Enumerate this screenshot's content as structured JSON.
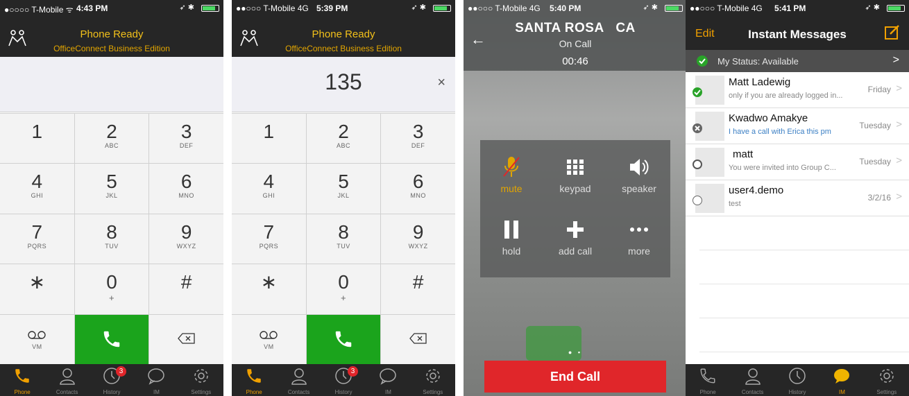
{
  "screens": {
    "dialer_empty": {
      "status": {
        "carrier": "●○○○○ T-Mobile ᯤ",
        "time": "4:43 PM"
      },
      "header": {
        "title": "Phone Ready",
        "subtitle": "OfficeConnect Business Edition",
        "logo_icon": "people-connect-icon"
      },
      "display_number": "",
      "keys": [
        {
          "digit": "1",
          "letters": ""
        },
        {
          "digit": "2",
          "letters": "ABC"
        },
        {
          "digit": "3",
          "letters": "DEF"
        },
        {
          "digit": "4",
          "letters": "GHI"
        },
        {
          "digit": "5",
          "letters": "JKL"
        },
        {
          "digit": "6",
          "letters": "MNO"
        },
        {
          "digit": "7",
          "letters": "PQRS"
        },
        {
          "digit": "8",
          "letters": "TUV"
        },
        {
          "digit": "9",
          "letters": "WXYZ"
        },
        {
          "digit": "∗",
          "letters": ""
        },
        {
          "digit": "0",
          "letters": "+"
        },
        {
          "digit": "#",
          "letters": ""
        }
      ],
      "voicemail_label": "VM",
      "tabs": [
        "Phone",
        "Contacts",
        "History",
        "IM",
        "Settings"
      ],
      "history_badge": "3"
    },
    "dialer_entered": {
      "status": {
        "carrier": "●●○○○ T-Mobile 4G",
        "time": "5:39 PM"
      },
      "header": {
        "title": "Phone Ready",
        "subtitle": "OfficeConnect Business Edition"
      },
      "display_number": "135",
      "clear_symbol": "×",
      "voicemail_label": "VM",
      "history_badge": "3"
    },
    "on_call": {
      "status": {
        "carrier": "●●○○○ T-Mobile 4G",
        "time": "5:40 PM"
      },
      "caller": "SANTA ROSA   CA",
      "state": "On Call",
      "duration": "00:46",
      "controls": [
        {
          "label": "mute",
          "icon": "microphone-muted-icon",
          "active": true
        },
        {
          "label": "keypad",
          "icon": "keypad-icon",
          "active": false
        },
        {
          "label": "speaker",
          "icon": "speaker-icon",
          "active": false
        },
        {
          "label": "hold",
          "icon": "pause-icon",
          "active": false
        },
        {
          "label": "add call",
          "icon": "plus-icon",
          "active": false
        },
        {
          "label": "more",
          "icon": "more-dots-icon",
          "active": false
        }
      ],
      "end_call_label": "End Call",
      "colors": {
        "end_call": "#e0262a",
        "muted": "#e2a500"
      }
    },
    "instant_messages": {
      "status": {
        "carrier": "●●○○○ T-Mobile 4G",
        "time": "5:41 PM"
      },
      "edit_label": "Edit",
      "title": "Instant Messages",
      "my_status": "My Status: Available",
      "conversations": [
        {
          "name": "Matt Ladewig",
          "preview": "only if you are already logged in...",
          "date": "Friday",
          "presence": "available"
        },
        {
          "name": "Kwadwo Amakye",
          "preview": "I have a call with Erica this pm",
          "date": "Tuesday",
          "presence": "offline"
        },
        {
          "name": "matt",
          "preview": "You were invited into Group C...",
          "date": "Tuesday",
          "presence": "group"
        },
        {
          "name": "user4.demo",
          "preview": "test",
          "date": "3/2/16",
          "presence": "unknown"
        }
      ],
      "tabs": [
        "Phone",
        "Contacts",
        "History",
        "IM",
        "Settings"
      ]
    }
  }
}
